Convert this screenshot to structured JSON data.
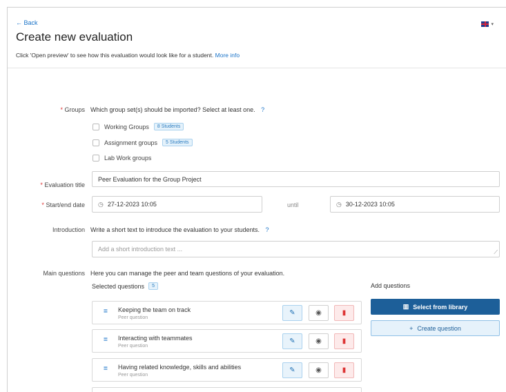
{
  "header": {
    "back_label": "← Back",
    "title": "Create new evaluation",
    "subtitle_text": "Click 'Open preview' to see how this evaluation would look like for a student.",
    "more_info_label": "More info",
    "language_caret": "▾"
  },
  "groups": {
    "required_mark": "*",
    "label": "Groups",
    "question": "Which group set(s) should be imported? Select at least one.",
    "help": "?",
    "options": [
      {
        "name": "Working Groups",
        "badge": "8 Students"
      },
      {
        "name": "Assignment groups",
        "badge": "5 Students"
      },
      {
        "name": "Lab Work groups",
        "badge": ""
      }
    ]
  },
  "evaluation_title": {
    "required_mark": "*",
    "label": "Evaluation title",
    "value": "Peer Evaluation for the Group Project"
  },
  "dates": {
    "required_mark": "*",
    "label": "Start/end date",
    "start": "27-12-2023 10:05",
    "until_label": "until",
    "end": "30-12-2023 10:05",
    "clock_icon": "◷"
  },
  "introduction": {
    "label": "Introduction",
    "text": "Write a short text to introduce the evaluation to your students.",
    "help": "?",
    "placeholder": "Add a short introduction text ..."
  },
  "main_questions": {
    "label": "Main questions",
    "text": "Here you can manage the peer and team questions of your evaluation.",
    "selected_label": "Selected questions",
    "selected_count": "5",
    "add_label": "Add questions",
    "select_library_label": "Select from library",
    "create_question_label": "Create question",
    "questions": [
      {
        "title": "Keeping the team on track",
        "type": "Peer question"
      },
      {
        "title": "Interacting with teammates",
        "type": "Peer question"
      },
      {
        "title": "Having related knowledge, skills and abilities",
        "type": "Peer question"
      }
    ]
  },
  "colors": {
    "link": "#1a73c8",
    "primary_button": "#1d5f99",
    "required": "#dd3333",
    "delete": "#dd3333"
  }
}
